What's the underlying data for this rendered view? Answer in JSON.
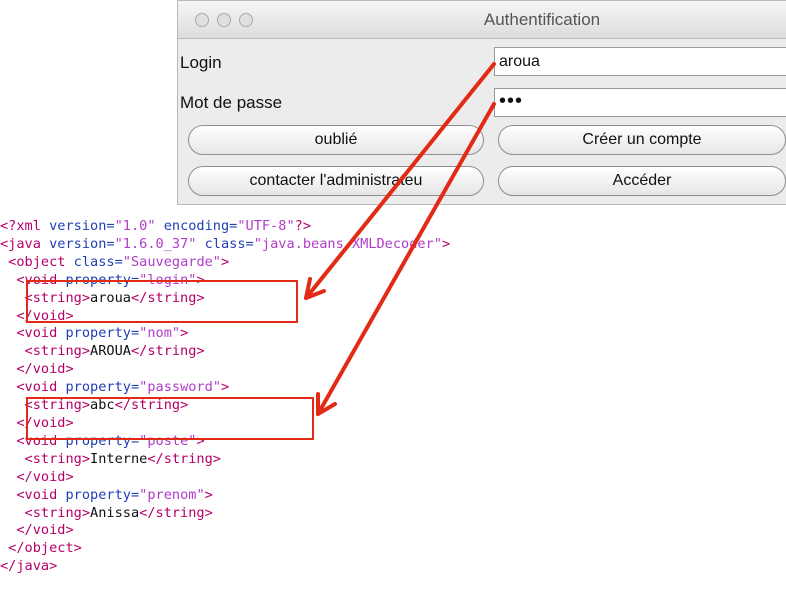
{
  "window": {
    "title": "Authentification",
    "login_label": "Login",
    "login_value": "aroua",
    "password_label": "Mot de passe",
    "password_value": "•••",
    "btn_forgot": "oublié",
    "btn_create": "Créer un compte",
    "btn_contact": "contacter l'administrateu",
    "btn_access": "Accéder"
  },
  "xml": {
    "l1_a": "<?xml ",
    "l1_b": "version=",
    "l1_c": "\"1.0\"",
    "l1_d": " encoding=",
    "l1_e": "\"UTF-8\"",
    "l1_f": "?>",
    "l2_a": "<java ",
    "l2_b": "version=",
    "l2_c": "\"1.6.0_37\"",
    "l2_d": " class=",
    "l2_e": "\"java.beans.XMLDecoder\"",
    "l2_f": ">",
    "l3_a": " <object ",
    "l3_b": "class=",
    "l3_c": "\"Sauvegarde\"",
    "l3_d": ">",
    "p1_a": "  <void ",
    "p1_b": "property=",
    "p1_c": "\"login\"",
    "p1_d": ">",
    "s1_a": "   <string>",
    "s1_b": "aroua",
    "s1_c": "</string>",
    "c1": "  </void>",
    "p2_a": "  <void ",
    "p2_b": "property=",
    "p2_c": "\"nom\"",
    "p2_d": ">",
    "s2_a": "   <string>",
    "s2_b": "AROUA",
    "s2_c": "</string>",
    "c2": "  </void>",
    "p3_a": "  <void ",
    "p3_b": "property=",
    "p3_c": "\"password\"",
    "p3_d": ">",
    "s3_a": "   <string>",
    "s3_b": "abc",
    "s3_c": "</string>",
    "c3": "  </void>",
    "p4_a": "  <void ",
    "p4_b": "property=",
    "p4_c": "\"poste\"",
    "p4_d": ">",
    "s4_a": "   <string>",
    "s4_b": "Interne",
    "s4_c": "</string>",
    "c4": "  </void>",
    "p5_a": "  <void ",
    "p5_b": "property=",
    "p5_c": "\"prenom\"",
    "p5_d": ">",
    "s5_a": "   <string>",
    "s5_b": "Anissa",
    "s5_c": "</string>",
    "c5": "  </void>",
    "obj_close": " </object>",
    "java_close": "</java>"
  },
  "colors": {
    "tag": "#b5006a",
    "attribute": "#1f3fb3",
    "value": "#b03cc9",
    "annotation": "#e22a14"
  }
}
